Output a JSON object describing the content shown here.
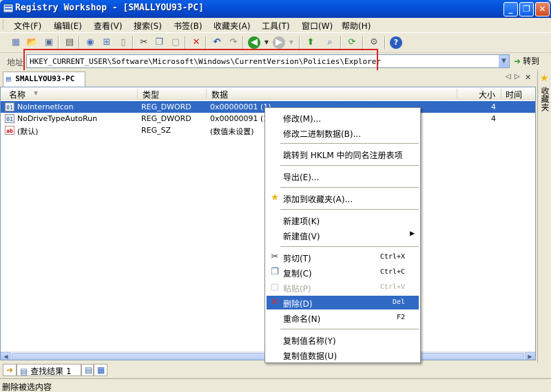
{
  "window": {
    "title": "Registry Workshop - [SMALLYOU93-PC]",
    "minimize_glyph": "_",
    "restore_glyph": "❐",
    "close_glyph": "✕"
  },
  "menu": [
    "文件(F)",
    "编辑(E)",
    "查看(V)",
    "搜索(S)",
    "书签(B)",
    "收藏夹(A)",
    "工具(T)",
    "窗口(W)",
    "帮助(H)"
  ],
  "toolbar_icons": [
    "registry-icon",
    "open-icon",
    "save-icon",
    "computer-icon",
    "connect-icon",
    "network-icon",
    "disconnect-icon",
    "cut-icon",
    "copy-icon",
    "paste-icon",
    "delete-icon",
    "undo-icon",
    "redo-icon",
    "back-icon",
    "forward-icon",
    "up-icon",
    "find-icon",
    "refresh-icon",
    "settings-icon",
    "help-icon"
  ],
  "address": {
    "label": "地址",
    "value": "HKEY_CURRENT_USER\\Software\\Microsoft\\Windows\\CurrentVersion\\Policies\\Explorer",
    "goto_label": "转到",
    "highlight_color": "#e02020"
  },
  "tab": {
    "label": "SMALLYOU93-PC"
  },
  "side_panel": {
    "label": "收藏夹"
  },
  "list": {
    "columns": [
      "名称",
      "类型",
      "数据",
      "大小",
      "时间"
    ],
    "rows": [
      {
        "icon": "dword-icon",
        "name": "NoInternetIcon",
        "type": "REG_DWORD",
        "data": "0x00000001 (1)",
        "size": "4"
      },
      {
        "icon": "dword-icon",
        "name": "NoDriveTypeAutoRun",
        "type": "REG_DWORD",
        "data": "0x00000091 (145)",
        "size": "4"
      },
      {
        "icon": "string-icon",
        "name": "(默认)",
        "type": "REG_SZ",
        "data": "(数值未设置)",
        "size": ""
      }
    ]
  },
  "context_menu": {
    "items": [
      {
        "label": "修改(M)...",
        "shortcut": ""
      },
      {
        "label": "修改二进制数据(B)...",
        "shortcut": ""
      },
      {
        "label": "跳转到 HKLM 中的同名注册表项",
        "shortcut": ""
      },
      {
        "label": "导出(E)...",
        "shortcut": ""
      },
      {
        "label": "添加到收藏夹(A)...",
        "shortcut": "",
        "icon": "star-icon"
      },
      {
        "label": "新建项(K)",
        "shortcut": ""
      },
      {
        "label": "新建值(V)",
        "shortcut": "",
        "submenu": true
      },
      {
        "label": "剪切(T)",
        "shortcut": "Ctrl+X",
        "icon": "cut-icon"
      },
      {
        "label": "复制(C)",
        "shortcut": "Ctrl+C",
        "icon": "copy-icon"
      },
      {
        "label": "粘贴(P)",
        "shortcut": "Ctrl+V",
        "icon": "paste-icon",
        "disabled": true
      },
      {
        "label": "删除(D)",
        "shortcut": "Del",
        "icon": "delete-icon",
        "highlighted": true
      },
      {
        "label": "重命名(N)",
        "shortcut": "F2"
      },
      {
        "label": "复制值名称(Y)",
        "shortcut": ""
      },
      {
        "label": "复制值数据(U)",
        "shortcut": ""
      }
    ]
  },
  "bottom_tabs": {
    "search_results": "查找结果 1"
  },
  "status": {
    "text": "删除被选内容"
  },
  "colors": {
    "selection": "#316ac5",
    "titlebar": "#0550d8"
  }
}
